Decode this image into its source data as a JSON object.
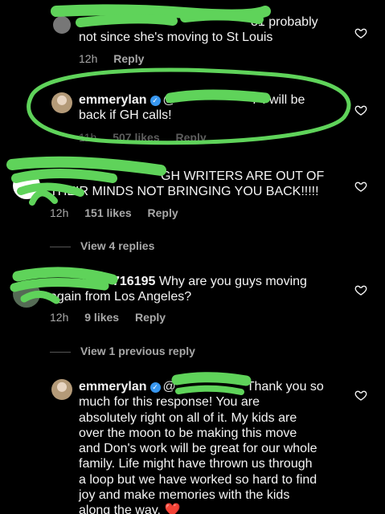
{
  "comments": [
    {
      "username": "",
      "text_line1": "81 probably",
      "text_line2": "not since she's moving to St Louis",
      "time": "12h",
      "reply_label": "Reply"
    },
    {
      "username": "emmerylan",
      "mention": "@",
      "text_line1": "7 I will be",
      "text_line2": "back if GH calls!",
      "time": "11h",
      "likes": "507 likes",
      "reply_label": "Reply"
    },
    {
      "username": "",
      "text_line1": "GH WRITERS ARE OUT OF",
      "text_line2": "THEIR MINDS NOT BRINGING YOU BACK!!!!!",
      "time": "12h",
      "likes": "151 likes",
      "reply_label": "Reply"
    },
    {
      "username": "716195",
      "text_line1": "Why are you guys moving",
      "text_line2": "again from Los Angeles?",
      "time": "12h",
      "likes": "9 likes",
      "reply_label": "Reply"
    },
    {
      "username": "emmerylan",
      "mention": "@",
      "lines": [
        "Thank you so",
        "much for this response! You are",
        "absolutely right on all of it. My kids are",
        "over the moon to be making this move",
        "and Don's work will be great for our whole",
        "family. Life might have thrown us through",
        "a loop but we have worked so hard to find",
        "joy and make memories with the kids",
        "along the way."
      ],
      "emoji": "❤️"
    }
  ],
  "threads": {
    "view_replies": "View 4 replies",
    "view_previous": "View 1 previous reply"
  },
  "colors": {
    "background": "#000000",
    "text": "#f5f5f5",
    "secondary": "#a8a8a8",
    "verified": "#3897f0",
    "scribble": "#5fd35a"
  },
  "icons": [
    "heart-outline-icon",
    "verified-badge-icon"
  ]
}
